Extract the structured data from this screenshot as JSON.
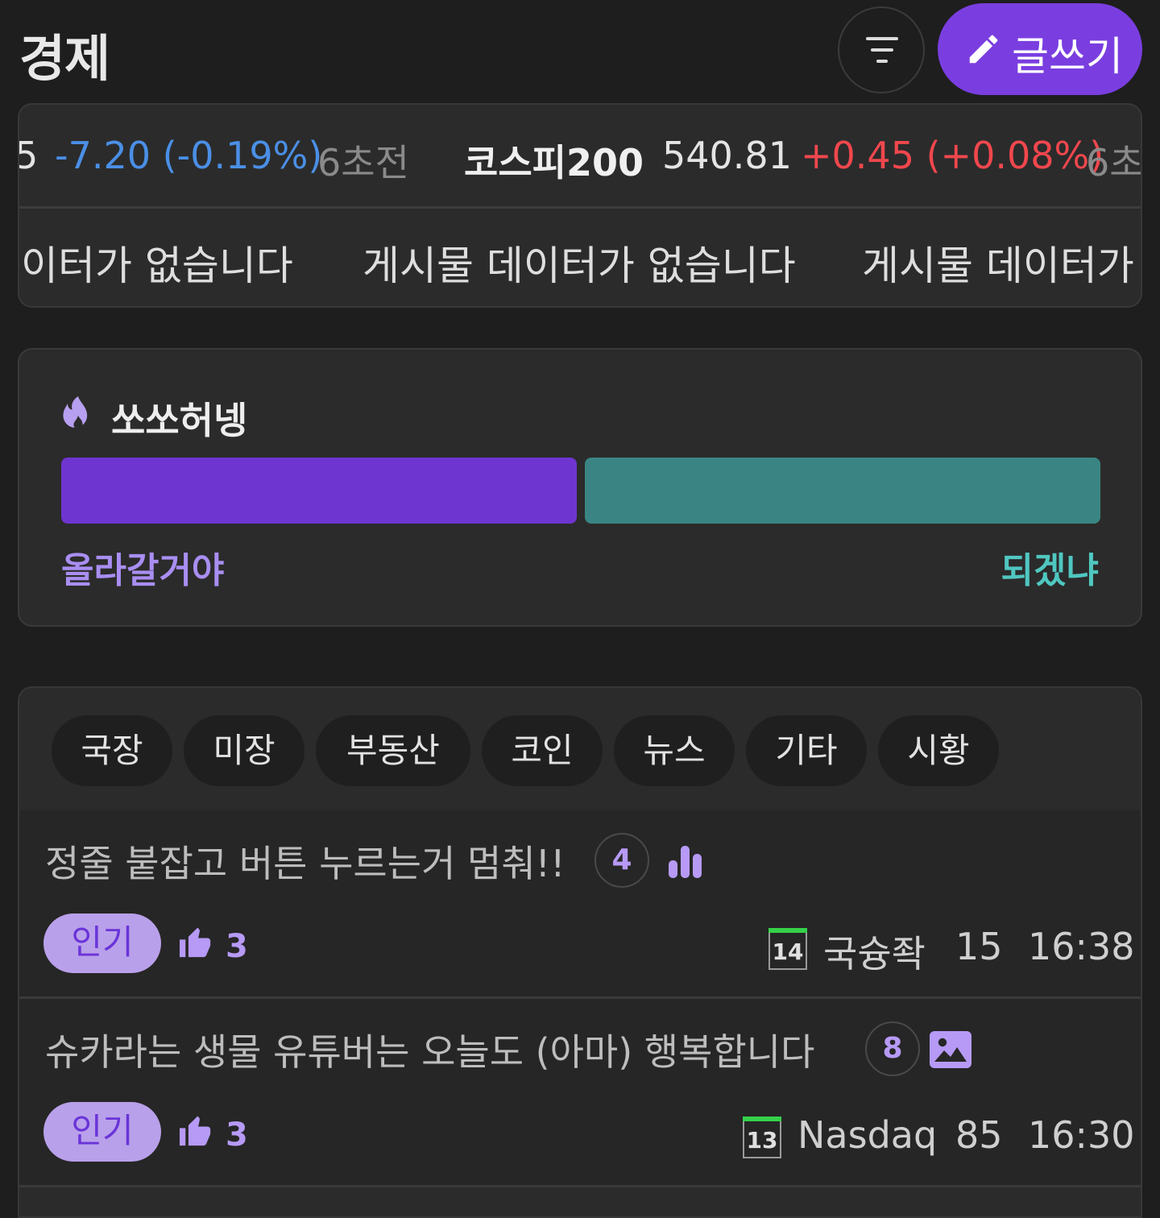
{
  "header": {
    "title": "경제",
    "write_label": "글쓰기"
  },
  "ticker": {
    "prev_partial_value": "5",
    "prev_change": "-7.20 (-0.19%)",
    "prev_time": "6초전",
    "name": "코스피200",
    "value": "540.81",
    "change": "+0.45 (+0.08%)",
    "time_partial": "6초",
    "colors": {
      "down": "#4a8fe6",
      "up": "#f0474d"
    }
  },
  "marquee": {
    "msg_partial_left": "이터가 없습니다",
    "msg": "게시물 데이터가 없습니다",
    "msg_partial_right": "게시물 데이터가 없"
  },
  "poll": {
    "icon": "flame-icon",
    "title": "쏘쏘허넹",
    "left_option": "올라갈거야",
    "right_option": "되겠냐",
    "left_share": 0.5,
    "right_share": 0.5,
    "colors": {
      "left": "#6f35d0",
      "right": "#3a8583"
    }
  },
  "categories": [
    "국장",
    "미장",
    "부동산",
    "코인",
    "뉴스",
    "기타",
    "시황"
  ],
  "posts": [
    {
      "title": "정줄 붙잡고 버튼 누르는거 멈춰!!",
      "comments": "4",
      "attachment_icon": "poll-chart-icon",
      "badge": "인기",
      "likes": "3",
      "level": "14",
      "author": "국슝좍",
      "views": "15",
      "time": "16:38"
    },
    {
      "title": "슈카라는 생물 유튜버는 오늘도 (아마) 행복합니다",
      "comments": "8",
      "attachment_icon": "image-icon",
      "badge": "인기",
      "likes": "3",
      "level": "13",
      "author": "Nasdaq",
      "views": "85",
      "time": "16:30"
    }
  ]
}
